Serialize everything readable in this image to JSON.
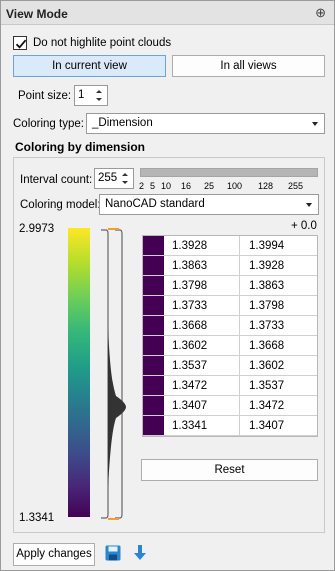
{
  "window": {
    "title": "View Mode",
    "pin_icon": "pin-icon"
  },
  "checkbox": {
    "label": "Do not highlite point clouds",
    "checked": true
  },
  "view_buttons": {
    "current": "In current view",
    "all": "In all views"
  },
  "point_size": {
    "label": "Point size:",
    "value": "1"
  },
  "coloring_type": {
    "label": "Coloring type:",
    "value": "_Dimension"
  },
  "group": {
    "title": "Coloring by dimension"
  },
  "interval": {
    "label": "Interval count:",
    "value": "255",
    "ticks": [
      "2",
      "5",
      "10",
      "16",
      "25",
      "100",
      "128",
      "255"
    ],
    "slider_value": 255
  },
  "coloring_model": {
    "label": "Coloring model:",
    "value": "NanoCAD standard"
  },
  "legend": {
    "max": "2.9973",
    "min": "1.3341",
    "offset": "+ 0.0"
  },
  "table": {
    "swatch_color": "#440154",
    "rows": [
      [
        "1.3928",
        "1.3994"
      ],
      [
        "1.3863",
        "1.3928"
      ],
      [
        "1.3798",
        "1.3863"
      ],
      [
        "1.3733",
        "1.3798"
      ],
      [
        "1.3668",
        "1.3733"
      ],
      [
        "1.3602",
        "1.3668"
      ],
      [
        "1.3537",
        "1.3602"
      ],
      [
        "1.3472",
        "1.3537"
      ],
      [
        "1.3407",
        "1.3472"
      ],
      [
        "1.3341",
        "1.3407"
      ]
    ]
  },
  "reset_label": "Reset",
  "apply_label": "Apply changes",
  "colors": {
    "accent": "#2a86d1",
    "active_button": "#dbeaf8"
  },
  "icons": {
    "save": "save-icon",
    "download": "download-arrow-icon"
  }
}
